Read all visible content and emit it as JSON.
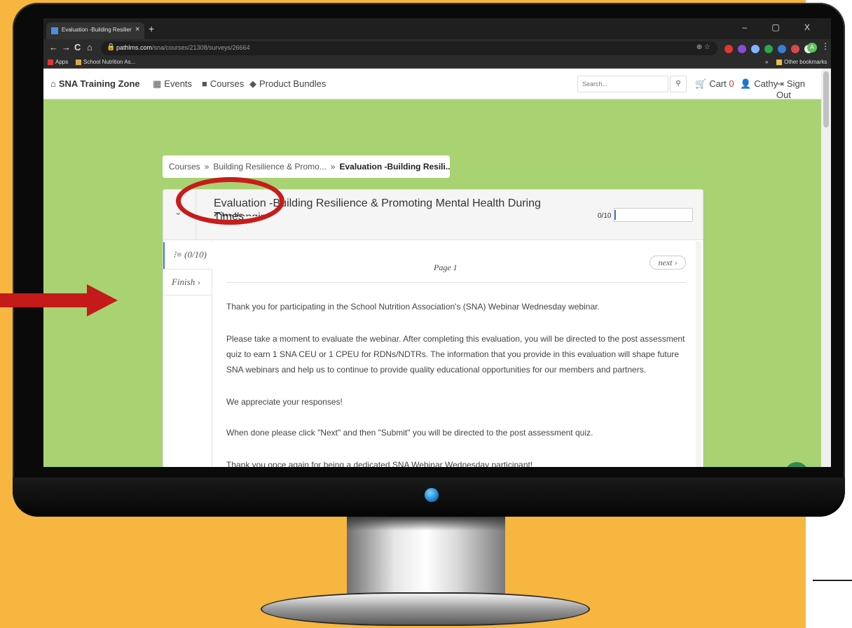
{
  "browser": {
    "tab_title": "Evaluation -Building Resilience &",
    "tab_close": "×",
    "new_tab": "+",
    "window_controls": "– ▢ X",
    "back": "←",
    "forward": "→",
    "reload": "C",
    "home": "⌂",
    "url_host": "pathlms.com",
    "url_path": "/sna/courses/21308/surveys/26664",
    "omnibox_icons": "⊕ ☆",
    "profile_initial": "A",
    "menu": "⋮",
    "bookmarks": {
      "apps": "Apps",
      "school": "School Nutrition As...",
      "more": "»",
      "other": "Other bookmarks"
    },
    "extension_colors": [
      "#e0382f",
      "#8a4bd8",
      "#7fb6ff",
      "#2aa84a",
      "#3a7bd5",
      "#d84a4a",
      "#f0f0f0"
    ]
  },
  "site": {
    "brand": "SNA Training Zone",
    "nav": {
      "events": "Events",
      "courses": "Courses",
      "bundles": "Product Bundles"
    },
    "search_placeholder": "Search...",
    "cart_label": "Cart",
    "cart_count": "0",
    "user": "Cathy",
    "sign_out": "Sign Out"
  },
  "breadcrumb": {
    "courses": "Courses",
    "sep": "»",
    "course": "Building Resilience & Promo...",
    "current": "Evaluation -Building Resili..."
  },
  "survey": {
    "title": "Evaluation -Building Resilience & Promoting Mental Health During Challenging",
    "title_cut": "Times",
    "progress_text": "0/10",
    "progress_fraction": 0,
    "sidebar_progress": "(0/10)",
    "sidebar_finish": "Finish",
    "page_label": "Page 1",
    "next_label": "next",
    "paragraphs": [
      "Thank you for participating in the School Nutrition Association's (SNA) Webinar Wednesday webinar.",
      "Please take a moment to evaluate the webinar. After completing this evaluation, you will be directed to the post assessment quiz to earn 1 SNA CEU or 1 CPEU for RDNs/NDTRs. The information that you provide in this evaluation will shape future SNA webinars and help us to continue to provide quality educational opportunities for our members and partners.",
      "We appreciate your responses!",
      "When done please click \"Next\" and then \"Submit\" you will be directed to the post assessment quiz.",
      "Thank you once again for being a dedicated SNA Webinar Wednesday participant!"
    ]
  },
  "colors": {
    "page_background": "#f6b63f",
    "screen_background": "#a9d372",
    "annotation_red": "#c41a1a",
    "accent_blue": "#3a7bd5"
  }
}
